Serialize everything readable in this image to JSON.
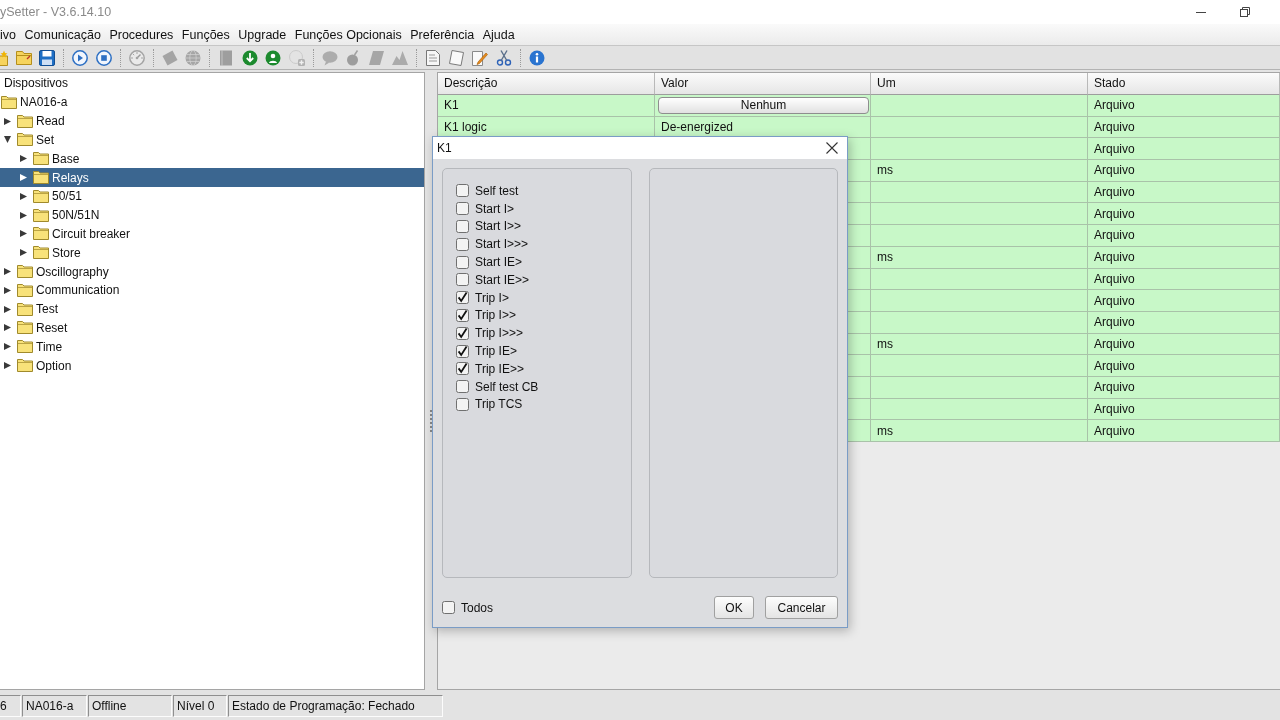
{
  "window": {
    "title": "ySetter - V3.6.14.10"
  },
  "menu": [
    "ivo",
    "Comunicação",
    "Procedures",
    "Funções",
    "Upgrade",
    "Funções Opcionais",
    "Preferência",
    "Ajuda"
  ],
  "toolbar": [
    [
      {
        "kind": "new",
        "disabled": false
      },
      {
        "kind": "open",
        "disabled": false
      },
      {
        "kind": "save",
        "disabled": false
      }
    ],
    [
      {
        "kind": "run",
        "disabled": false
      },
      {
        "kind": "stop",
        "disabled": false
      }
    ],
    [
      {
        "kind": "gauge",
        "disabled": true
      }
    ],
    [
      {
        "kind": "card",
        "disabled": true
      },
      {
        "kind": "globe",
        "disabled": true
      }
    ],
    [
      {
        "kind": "book",
        "disabled": true
      },
      {
        "kind": "download",
        "disabled": false
      },
      {
        "kind": "person",
        "disabled": false
      },
      {
        "kind": "add",
        "disabled": true
      }
    ],
    [
      {
        "kind": "comment",
        "disabled": true
      },
      {
        "kind": "bomb",
        "disabled": true
      },
      {
        "kind": "eraser",
        "disabled": true
      },
      {
        "kind": "mountain",
        "disabled": true
      }
    ],
    [
      {
        "kind": "document",
        "disabled": false
      },
      {
        "kind": "page",
        "disabled": false
      },
      {
        "kind": "edit",
        "disabled": false
      },
      {
        "kind": "cut",
        "disabled": false
      }
    ],
    [
      {
        "kind": "info",
        "disabled": false
      }
    ]
  ],
  "tree": {
    "header": "Dispositivos",
    "root": {
      "label": "NA016-a",
      "selected": false,
      "children": [
        {
          "label": "Read",
          "expanded": false,
          "selected": false
        },
        {
          "label": "Set",
          "expanded": true,
          "selected": false,
          "children": [
            {
              "label": "Base",
              "expanded": false,
              "selected": false
            },
            {
              "label": "Relays",
              "expanded": false,
              "selected": true
            },
            {
              "label": "50/51",
              "expanded": false,
              "selected": false
            },
            {
              "label": "50N/51N",
              "expanded": false,
              "selected": false
            },
            {
              "label": "Circuit breaker",
              "expanded": false,
              "selected": false
            },
            {
              "label": "Store",
              "expanded": false,
              "selected": false
            }
          ]
        },
        {
          "label": "Oscillography",
          "expanded": false,
          "selected": false
        },
        {
          "label": "Communication",
          "expanded": false,
          "selected": false
        },
        {
          "label": "Test",
          "expanded": false,
          "selected": false
        },
        {
          "label": "Reset",
          "expanded": false,
          "selected": false
        },
        {
          "label": "Time",
          "expanded": false,
          "selected": false
        },
        {
          "label": "Option",
          "expanded": false,
          "selected": false
        }
      ]
    }
  },
  "table": {
    "columns": [
      "Descrição",
      "Valor",
      "Um",
      "Stado"
    ],
    "rows": [
      {
        "kind": "button",
        "description": "K1",
        "value": "Nenhum",
        "status": "Arquivo"
      },
      {
        "kind": "text",
        "description": "K1 logic",
        "value": "De-energized",
        "status": "Arquivo"
      },
      {
        "status": "Arquivo"
      },
      {
        "unit": "ms",
        "status": "Arquivo"
      },
      {
        "status": "Arquivo"
      },
      {
        "status": "Arquivo"
      },
      {
        "status": "Arquivo"
      },
      {
        "unit": "ms",
        "status": "Arquivo"
      },
      {
        "status": "Arquivo"
      },
      {
        "status": "Arquivo"
      },
      {
        "status": "Arquivo"
      },
      {
        "unit": "ms",
        "status": "Arquivo"
      },
      {
        "status": "Arquivo"
      },
      {
        "status": "Arquivo"
      },
      {
        "status": "Arquivo"
      },
      {
        "unit": "ms",
        "status": "Arquivo"
      }
    ]
  },
  "dialog": {
    "title": "K1",
    "options": [
      {
        "label": "Self test",
        "checked": false
      },
      {
        "label": "Start I>",
        "checked": false
      },
      {
        "label": "Start I>>",
        "checked": false
      },
      {
        "label": "Start I>>>",
        "checked": false
      },
      {
        "label": "Start IE>",
        "checked": false
      },
      {
        "label": "Start IE>>",
        "checked": false
      },
      {
        "label": "Trip I>",
        "checked": true
      },
      {
        "label": "Trip I>>",
        "checked": true
      },
      {
        "label": "Trip I>>>",
        "checked": true
      },
      {
        "label": "Trip IE>",
        "checked": true
      },
      {
        "label": "Trip IE>>",
        "checked": true
      },
      {
        "label": "Self test CB",
        "checked": false
      },
      {
        "label": "Trip TCS",
        "checked": false
      }
    ],
    "select_all": {
      "label": "Todos",
      "checked": false
    },
    "buttons": [
      "OK",
      "Cancelar"
    ]
  },
  "status_bar": [
    "6",
    "NA016-a",
    "Offline",
    "Nível 0",
    "Estado de Programação: Fechado"
  ]
}
